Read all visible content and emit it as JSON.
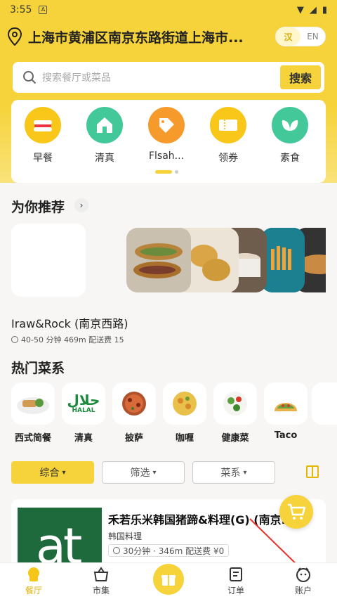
{
  "status_bar": {
    "time": "3:55",
    "notification_glyph": "A"
  },
  "location": {
    "address": "上海市黄浦区南京东路街道上海市..."
  },
  "language": {
    "zh": "汉",
    "en": "EN"
  },
  "search": {
    "placeholder": "搜索餐厅或菜品",
    "button": "搜索"
  },
  "categories": [
    {
      "label": "早餐",
      "icon": "hotdog-icon",
      "color": "#f9c61a"
    },
    {
      "label": "清真",
      "icon": "mosque-icon",
      "color": "#43c89a"
    },
    {
      "label": "Flsah...",
      "icon": "tag-icon",
      "color": "#f79a2c"
    },
    {
      "label": "领券",
      "icon": "coupon-icon",
      "color": "#f9c61a"
    },
    {
      "label": "素食",
      "icon": "leaf-icon",
      "color": "#43c89a"
    }
  ],
  "recommend": {
    "title": "为你推荐",
    "restaurant_name": "Iraw&Rock (南京西路)",
    "restaurant_meta": "40-50 分钟 469m 配送费 15"
  },
  "hot_cuisines": {
    "title": "热门菜系",
    "items": [
      {
        "label": "西式简餐"
      },
      {
        "label": "清真",
        "badge": "HALAL"
      },
      {
        "label": "披萨"
      },
      {
        "label": "咖喱"
      },
      {
        "label": "健康菜"
      },
      {
        "label": "Taco"
      }
    ]
  },
  "filters": {
    "sort": "综合",
    "filter": "筛选",
    "cuisine": "菜系"
  },
  "restaurant_card": {
    "name": "禾若乐米韩国猪蹄&料理(G) (南京...",
    "type": "韩国料理",
    "meta": "30分钟 · 346m  配送费 ¥0",
    "logo_text": "at"
  },
  "tabbar": [
    {
      "label": "餐厅"
    },
    {
      "label": "市集"
    },
    {
      "label": "订单"
    },
    {
      "label": "账户"
    }
  ]
}
